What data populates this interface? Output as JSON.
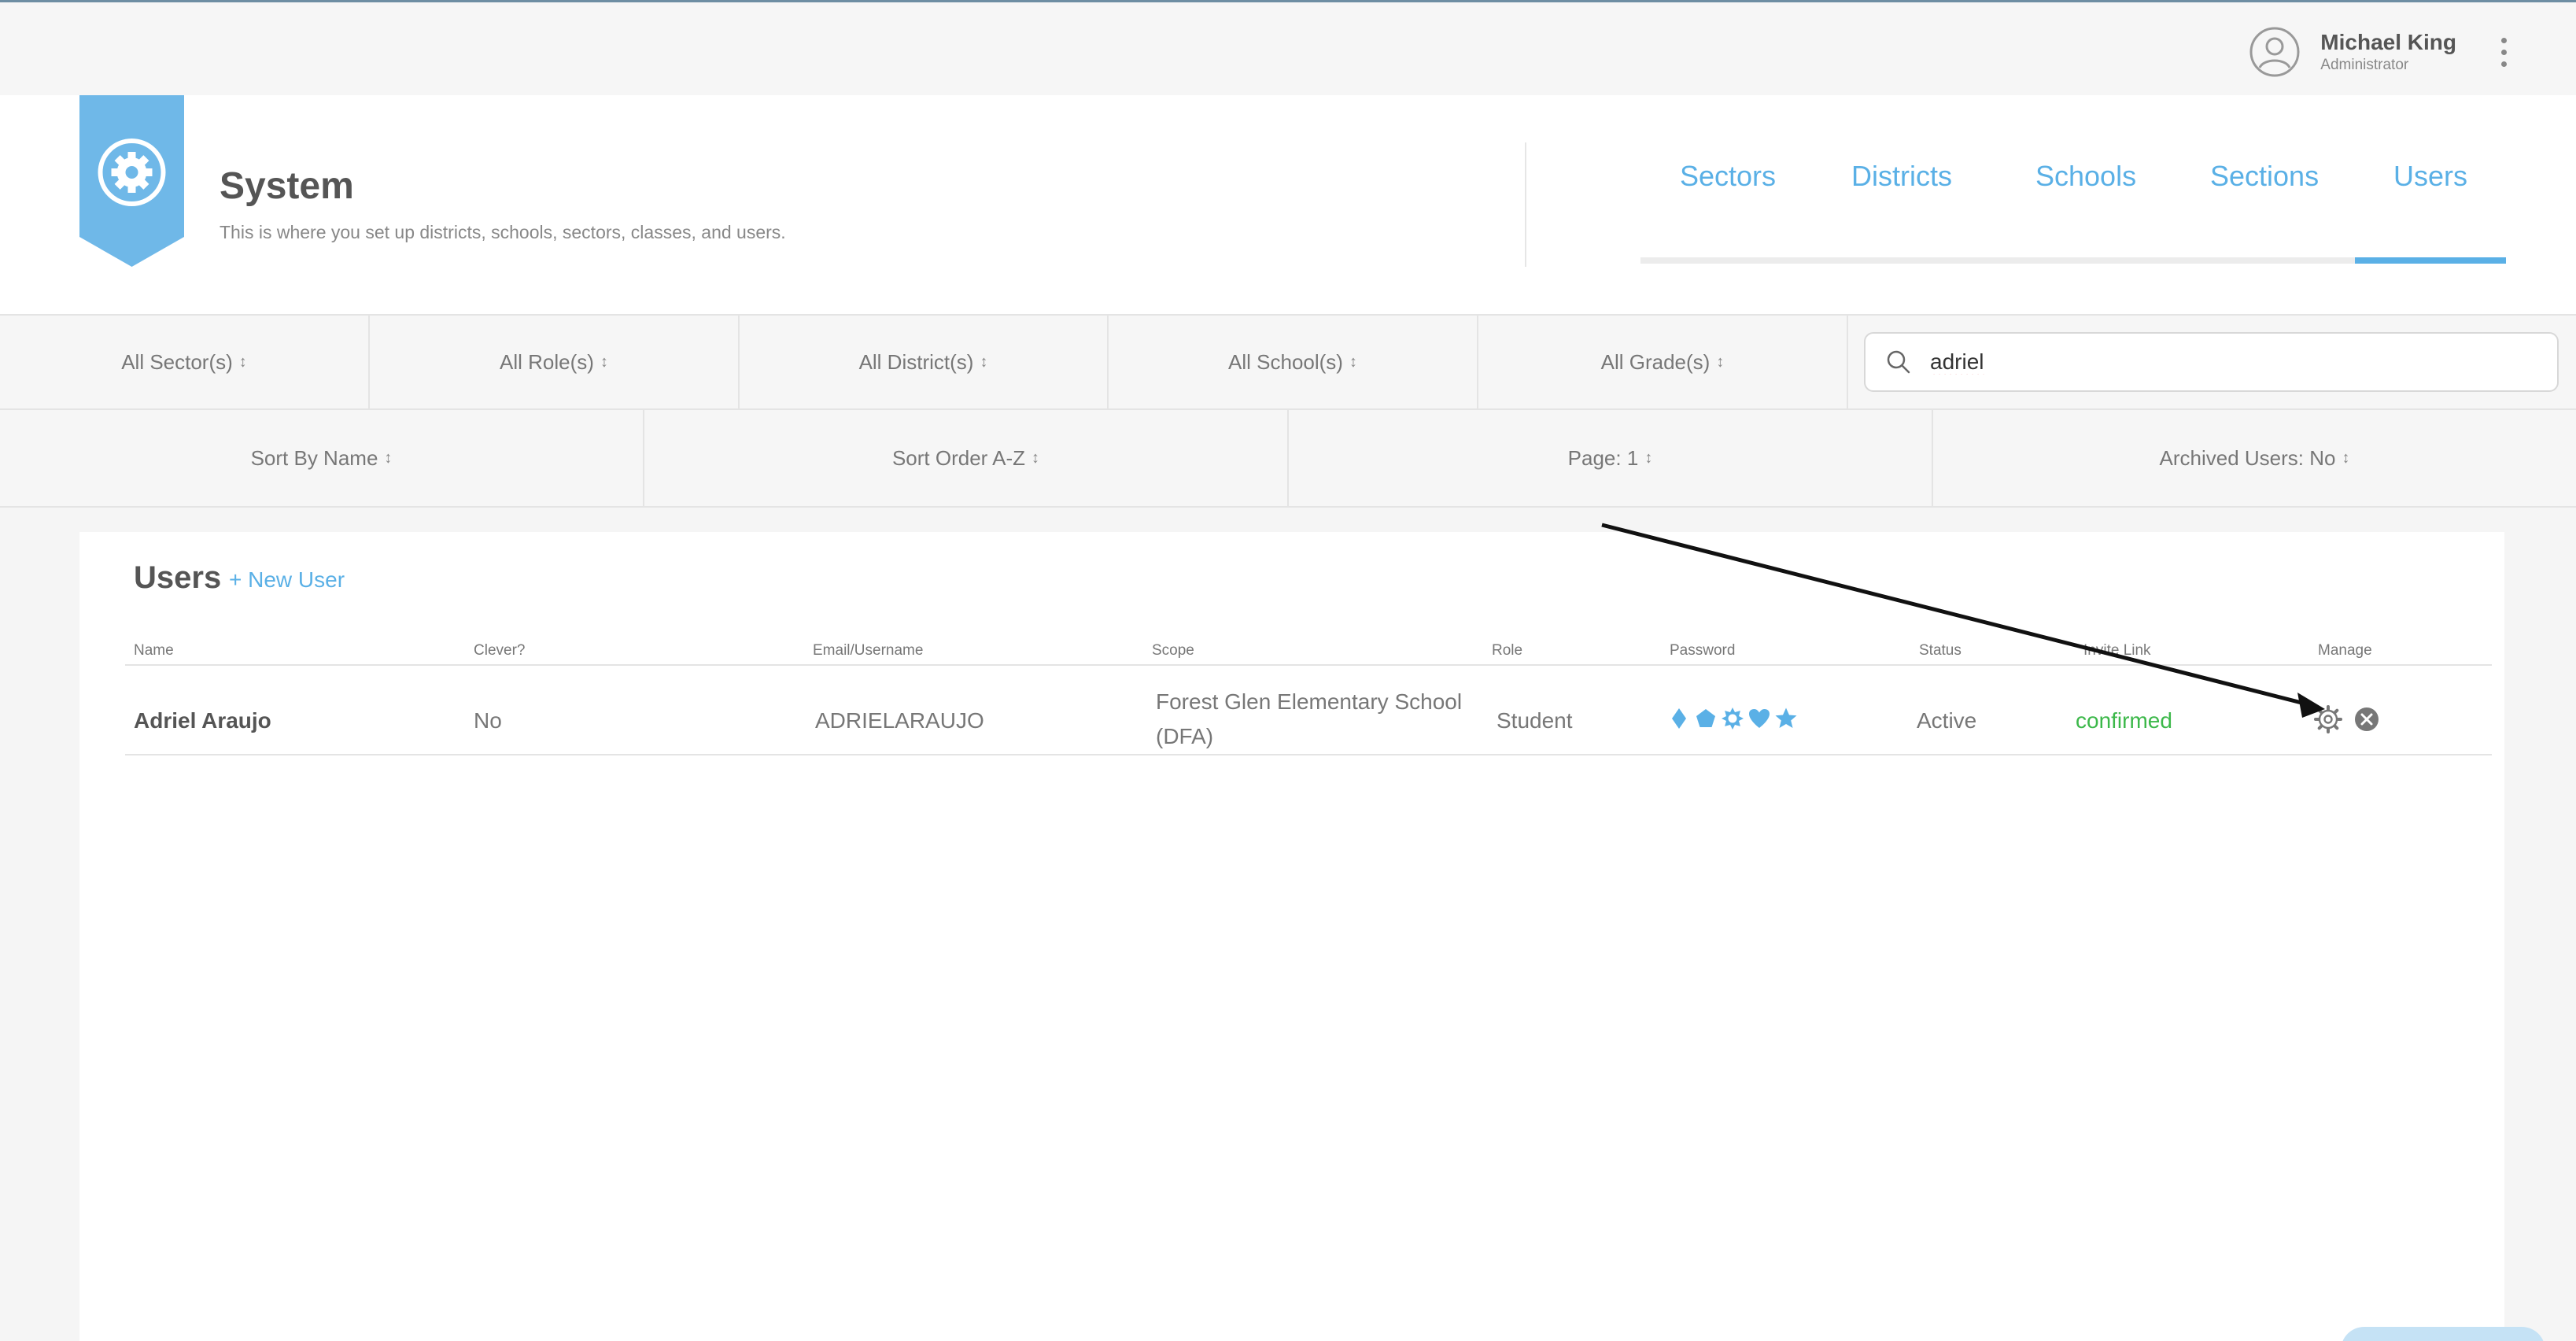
{
  "topbar": {
    "user_name": "Michael King",
    "user_role": "Administrator"
  },
  "header": {
    "title": "System",
    "subtitle": "This is where you set up districts, schools, sectors, classes, and users.",
    "tabs": [
      {
        "label": "Sectors"
      },
      {
        "label": "Districts"
      },
      {
        "label": "Schools"
      },
      {
        "label": "Sections"
      },
      {
        "label": "Users",
        "active": true
      }
    ]
  },
  "filters": {
    "sector": "All Sector(s)",
    "role": "All Role(s)",
    "district": "All District(s)",
    "school": "All School(s)",
    "grade": "All Grade(s)",
    "search_value": "adriel",
    "sort_by": "Sort By Name",
    "sort_order": "Sort Order A-Z",
    "page": "Page: 1",
    "archived": "Archived Users: No",
    "arrow_glyph": "↕"
  },
  "users": {
    "title": "Users",
    "new_user_label": "+ New User",
    "columns": [
      "Name",
      "Clever?",
      "Email/Username",
      "Scope",
      "Role",
      "Password",
      "Status",
      "Invite Link",
      "Manage"
    ],
    "rows": [
      {
        "name": "Adriel Araujo",
        "clever": "No",
        "email": "ADRIELARAUJO",
        "scope_line1": "Forest Glen Elementary School",
        "scope_line2": "(DFA)",
        "role": "Student",
        "password_icons": [
          "diamond-icon",
          "pentagon-icon",
          "sun-icon",
          "heart-icon",
          "star-icon"
        ],
        "status": "Active",
        "invite": "confirmed"
      }
    ]
  },
  "colors": {
    "accent": "#5ab0e6",
    "confirmed": "#3cb84a",
    "text": "#555555"
  }
}
